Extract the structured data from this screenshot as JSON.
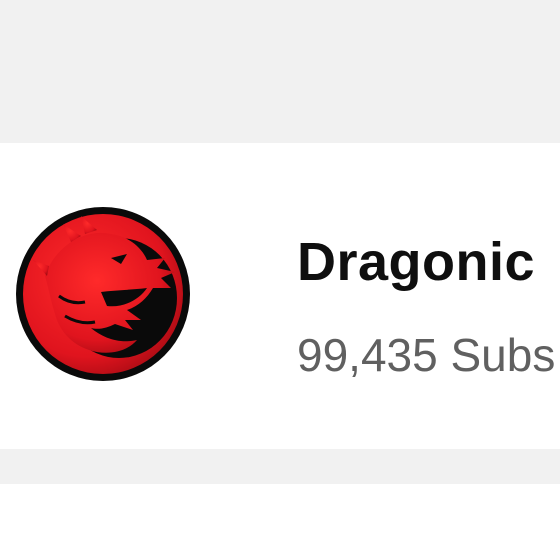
{
  "channel": {
    "name": "Dragonic",
    "subscribers": "99,435 Subs",
    "avatar_icon": "dragon-logo-icon"
  },
  "colors": {
    "background_band": "#f1f1f1",
    "card_background": "#ffffff",
    "name_text": "#0f0f0f",
    "subscriber_text": "#606060",
    "logo_red": "#e0141e",
    "logo_black": "#0a0a0a"
  }
}
